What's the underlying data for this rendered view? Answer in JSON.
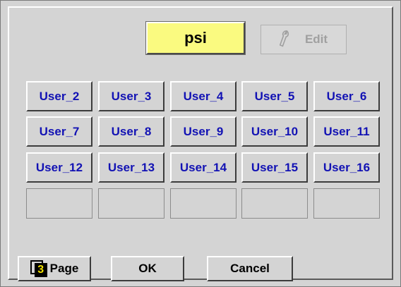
{
  "unit": {
    "value": "psi"
  },
  "edit": {
    "label": "Edit",
    "icon": "wrench-icon"
  },
  "users": [
    "User_2",
    "User_3",
    "User_4",
    "User_5",
    "User_6",
    "User_7",
    "User_8",
    "User_9",
    "User_10",
    "User_11",
    "User_12",
    "User_13",
    "User_14",
    "User_15",
    "User_16"
  ],
  "footer": {
    "page_number": "3",
    "page_label": "Page",
    "ok_label": "OK",
    "cancel_label": "Cancel"
  },
  "colors": {
    "unit_background": "#fafa80",
    "user_text": "#1212b4",
    "panel": "#d4d4d4"
  }
}
